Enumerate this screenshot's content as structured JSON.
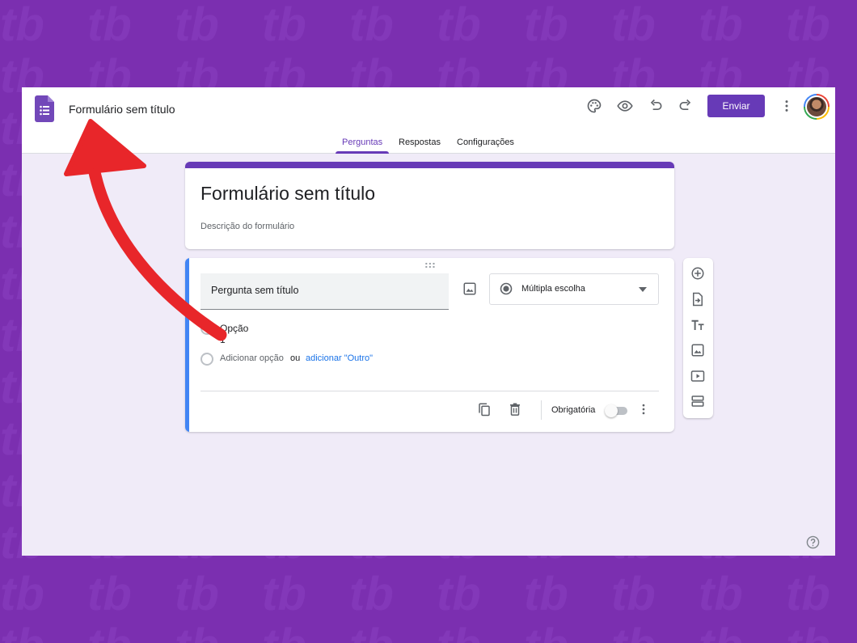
{
  "app": {
    "doc_title": "Formulário sem título"
  },
  "toolbar": {
    "send_label": "Enviar",
    "icons": [
      "palette-icon",
      "preview-eye-icon",
      "undo-icon",
      "redo-icon",
      "more-vert-icon"
    ]
  },
  "tabs": [
    {
      "label": "Perguntas",
      "active": true
    },
    {
      "label": "Respostas",
      "active": false
    },
    {
      "label": "Configurações",
      "active": false
    }
  ],
  "form": {
    "title": "Formulário sem título",
    "description_placeholder": "Descrição do formulário"
  },
  "question": {
    "title_placeholder": "Pergunta sem título",
    "type": "Múltipla escolha",
    "options": [
      "Opção 1"
    ],
    "add_option": "Adicionar opção",
    "or_text": "ou",
    "add_other": "adicionar \"Outro\"",
    "required_label": "Obrigatória",
    "required": false
  },
  "side_tools": [
    "add-question-icon",
    "import-questions-icon",
    "add-title-icon",
    "add-image-icon",
    "add-video-icon",
    "add-section-icon"
  ],
  "colors": {
    "accent": "#673ab7",
    "background": "#f0ebf8",
    "active_card": "#4285f4",
    "link": "#1a73e8",
    "annotation_arrow": "#e8262a",
    "page_backdrop": "#7b2fb0"
  }
}
